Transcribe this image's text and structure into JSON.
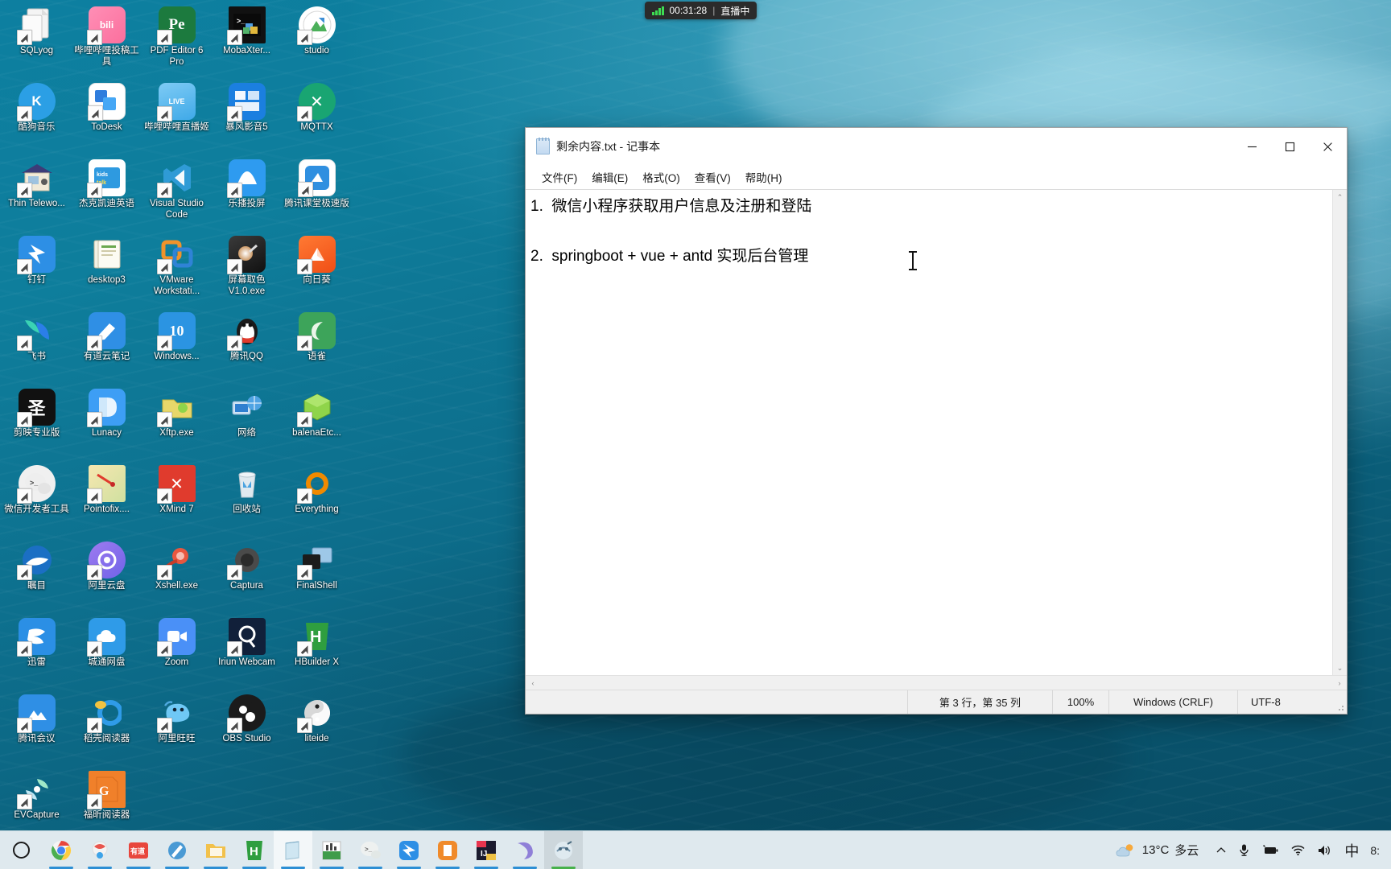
{
  "desktop": {
    "icons": [
      {
        "label": "SQLyog",
        "icon": "sqlyog-icon"
      },
      {
        "label": "哔哩哔哩投稿工具",
        "icon": "bilibili-upload-icon"
      },
      {
        "label": "PDF Editor 6 Pro",
        "icon": "pdf-editor-icon"
      },
      {
        "label": "MobaXter...",
        "icon": "mobaxterm-icon"
      },
      {
        "label": "studio",
        "icon": "studio-icon"
      },
      {
        "label": "酷狗音乐",
        "icon": "kugou-music-icon"
      },
      {
        "label": "ToDesk",
        "icon": "todesk-icon"
      },
      {
        "label": "哔哩哔哩直播姬",
        "icon": "bilibili-live-icon"
      },
      {
        "label": "暴风影音5",
        "icon": "baofeng-player-icon"
      },
      {
        "label": "MQTTX",
        "icon": "mqttx-icon"
      },
      {
        "label": "Thin Telewo...",
        "icon": "thin-telework-icon"
      },
      {
        "label": "杰克凯迪英语",
        "icon": "jack-kaidi-english-icon"
      },
      {
        "label": "Visual Studio Code",
        "icon": "vscode-icon"
      },
      {
        "label": "乐播投屏",
        "icon": "lebo-cast-icon"
      },
      {
        "label": "腾讯课堂极速版",
        "icon": "tencent-ketang-icon"
      },
      {
        "label": "钉钉",
        "icon": "dingtalk-icon"
      },
      {
        "label": "desktop3",
        "icon": "folder-desktop3-icon"
      },
      {
        "label": "VMware Workstati...",
        "icon": "vmware-icon"
      },
      {
        "label": "屏幕取色 V1.0.exe",
        "icon": "color-picker-icon"
      },
      {
        "label": "向日葵",
        "icon": "sunflower-icon"
      },
      {
        "label": "飞书",
        "icon": "feishu-icon"
      },
      {
        "label": "有道云笔记",
        "icon": "youdao-note-icon"
      },
      {
        "label": "Windows...",
        "icon": "windows10-icon"
      },
      {
        "label": "腾讯QQ",
        "icon": "tencent-qq-icon"
      },
      {
        "label": "语雀",
        "icon": "yuque-icon"
      },
      {
        "label": "剪映专业版",
        "icon": "jianying-icon"
      },
      {
        "label": "Lunacy",
        "icon": "lunacy-icon"
      },
      {
        "label": "Xftp.exe",
        "icon": "xftp-icon"
      },
      {
        "label": "网络",
        "icon": "network-icon"
      },
      {
        "label": "balenaEtc...",
        "icon": "balena-etcher-icon"
      },
      {
        "label": "微信开发者工具",
        "icon": "wechat-devtools-icon"
      },
      {
        "label": "Pointofix....",
        "icon": "pointofix-icon"
      },
      {
        "label": "XMind 7",
        "icon": "xmind-icon"
      },
      {
        "label": "回收站",
        "icon": "recycle-bin-icon"
      },
      {
        "label": "Everything",
        "icon": "everything-icon"
      },
      {
        "label": "瞩目",
        "icon": "zhumu-icon"
      },
      {
        "label": "阿里云盘",
        "icon": "aliyun-drive-icon"
      },
      {
        "label": "Xshell.exe",
        "icon": "xshell-icon"
      },
      {
        "label": "Captura",
        "icon": "captura-icon"
      },
      {
        "label": "FinalShell",
        "icon": "finalshell-icon"
      },
      {
        "label": "迅雷",
        "icon": "xunlei-icon"
      },
      {
        "label": "城通网盘",
        "icon": "ctfile-icon"
      },
      {
        "label": "Zoom",
        "icon": "zoom-icon"
      },
      {
        "label": "Iriun Webcam",
        "icon": "iriun-webcam-icon"
      },
      {
        "label": "HBuilder X",
        "icon": "hbuilderx-icon"
      },
      {
        "label": "腾讯会议",
        "icon": "tencent-meeting-icon"
      },
      {
        "label": "稻壳阅读器",
        "icon": "daoke-reader-icon"
      },
      {
        "label": "阿里旺旺",
        "icon": "aliwangwang-icon"
      },
      {
        "label": "OBS Studio",
        "icon": "obs-studio-icon"
      },
      {
        "label": "liteide",
        "icon": "liteide-icon"
      },
      {
        "label": "EVCapture",
        "icon": "evcapture-icon"
      },
      {
        "label": "福昕阅读器",
        "icon": "foxit-reader-icon"
      }
    ]
  },
  "recording_overlay": {
    "elapsed": "00:31:28",
    "separator": "|",
    "status": "直播中",
    "signal_icon": "signal-bars-icon"
  },
  "notepad": {
    "title": "剩余内容.txt - 记事本",
    "app_icon": "notepad-icon",
    "window_buttons": {
      "minimize": "−",
      "maximize": "▢",
      "close": "✕"
    },
    "menu": [
      "文件(F)",
      "编辑(E)",
      "格式(O)",
      "查看(V)",
      "帮助(H)"
    ],
    "content_lines": [
      "1.  微信小程序获取用户信息及注册和登陆",
      "",
      "2.  springboot + vue + antd 实现后台管理"
    ],
    "statusbar": {
      "position": "第 3 行，第 35 列",
      "zoom": "100%",
      "eol": "Windows (CRLF)",
      "encoding": "UTF-8"
    },
    "scrollbar": {
      "up_arrow": "⌃",
      "down_arrow": "⌄",
      "left_arrow": "‹",
      "right_arrow": "›"
    }
  },
  "taskbar": {
    "start_icon": "start-ring-icon",
    "items": [
      {
        "name": "chrome",
        "icon": "chrome-icon"
      },
      {
        "name": "quark-browser",
        "icon": "quark-browser-icon"
      },
      {
        "name": "youdao-dict",
        "icon": "youdao-dict-icon",
        "label": "有道"
      },
      {
        "name": "wps-pen",
        "icon": "wps-pen-icon"
      },
      {
        "name": "file-explorer",
        "icon": "file-explorer-icon"
      },
      {
        "name": "hbuilderx",
        "icon": "hbuilderx-icon",
        "label": "H"
      },
      {
        "name": "notepad",
        "icon": "notepad-icon"
      },
      {
        "name": "excel-chart",
        "icon": "excel-chart-icon"
      },
      {
        "name": "wechat-devtools",
        "icon": "wechat-devtools-icon"
      },
      {
        "name": "dingtalk",
        "icon": "dingtalk-icon"
      },
      {
        "name": "daoke-reader",
        "icon": "daoke-reader-icon"
      },
      {
        "name": "intellij-idea",
        "icon": "intellij-idea-icon",
        "label": "IJ"
      },
      {
        "name": "navicat",
        "icon": "navicat-icon"
      },
      {
        "name": "mobaxterm",
        "icon": "mobaxterm-icon"
      }
    ],
    "tray": {
      "weather_temp": "13°C",
      "weather_desc": "多云",
      "weather_icon": "partly-cloudy-icon",
      "chevron_icon": "chevron-up-icon",
      "mic_icon": "microphone-icon",
      "battery_icon": "battery-charging-icon",
      "wifi_icon": "wifi-icon",
      "volume_icon": "speaker-icon",
      "ime_label": "中",
      "clock": "8:"
    }
  },
  "colors": {
    "desktop_teal": "#0d7fa0",
    "taskbar": "#dfe9ee",
    "accent_blue": "#2d8fd4",
    "recording_green": "#3ddc52"
  }
}
